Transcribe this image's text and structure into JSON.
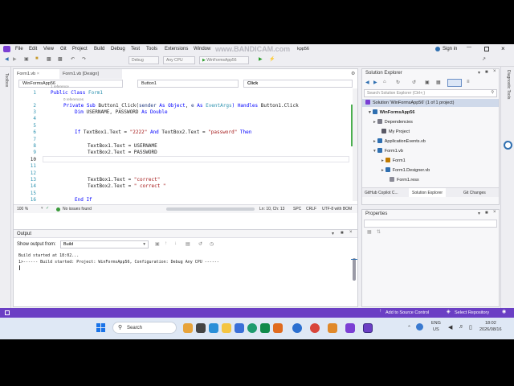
{
  "menu": {
    "items": [
      "File",
      "Edit",
      "View",
      "Git",
      "Project",
      "Build",
      "Debug",
      "Test",
      "Tools",
      "Extensions",
      "Window"
    ],
    "watermark": "www.BANDICAM.com",
    "window_title_suffix": "kpp56",
    "sign_in": "Sign in"
  },
  "toolbar": {
    "config": "Debug",
    "platform": "Any CPU",
    "run": "WinFormsApp56"
  },
  "left_strip": {
    "label": "Toolbox"
  },
  "right_strip": {
    "label": "Diagnostic Tools"
  },
  "editor": {
    "tabs": [
      "Form1.vb",
      "Form1.vb [Design]"
    ],
    "dropdowns": {
      "project": "WinFormsApp56",
      "object": "Button1",
      "event": "Click"
    },
    "references_1": "1 reference",
    "references_2": "0 references",
    "line_numbers": [
      "1",
      "2",
      "3",
      "4",
      "5",
      "6",
      "7",
      "8",
      "9",
      "10",
      "11",
      "12",
      "13",
      "14",
      "15",
      "16"
    ],
    "zoom": "100 %",
    "issues": "No issues found",
    "position": "Ln: 10, Ch: 13",
    "spc": "SPC",
    "crlf": "CRLF",
    "encoding": "UTF-8 with BOM"
  },
  "code": {
    "l1_kw": "Public Class ",
    "l1_name": "Form1",
    "l2_kw": "Private Sub ",
    "l2_rest": "Button1_Click(",
    "l2_sender": "sender",
    "l2_as1": " As ",
    "l2_obj": "Object",
    "l2_comma": ", ",
    "l2_e": "e",
    "l2_as2": " As ",
    "l2_ev": "EventArgs",
    "l2_handles": ") Handles ",
    "l2_tail": "Button1.Click",
    "l3_kw": "Dim ",
    "l3_vars": "USERNAME, PASSWORD ",
    "l3_as": "As ",
    "l3_type": "Double",
    "l6_if": "If ",
    "l6_a": "TextBox1.Text = ",
    "l6_s1": "\"2222\"",
    "l6_and": " And ",
    "l6_b": "TextBox2.Text = ",
    "l6_s2": "\"password\"",
    "l6_then": " Then",
    "l8": "TextBox1.Text = USERNAME",
    "l9": "TextBox2.Text = PASSWORD",
    "l13_a": "TextBox1.Text = ",
    "l13_s": "\"correct\"",
    "l14_a": "TextBox2.Text = ",
    "l14_s": "\" correct \"",
    "l16": "End If"
  },
  "output": {
    "title": "Output",
    "show_from_label": "Show output from:",
    "show_from_value": "Build",
    "line1": "Build started at 18:02...",
    "line2": "1>------ Build started: Project: WinFormsApp56, Configuration: Debug Any CPU ------"
  },
  "solution_explorer": {
    "title": "Solution Explorer",
    "search_placeholder": "Search Solution Explorer (Ctrl+;)",
    "items": [
      "Solution 'WinFormsApp56' (1 of 1 project)",
      "WinFormsApp56",
      "Dependencies",
      "My Project",
      "ApplicationEvents.vb",
      "Form1.vb",
      "Form1",
      "Form1.Designer.vb",
      "Form1.resx"
    ],
    "bottom_tabs": [
      "GitHub Copilot C...",
      "Solution Explorer",
      "Git Changes"
    ]
  },
  "properties": {
    "title": "Properties"
  },
  "statusbar": {
    "add_source": "Add to Source Control",
    "select_repo": "Select Repository"
  },
  "taskbar": {
    "search": "Search",
    "lang1": "ENG",
    "lang2": "US",
    "time": "18:02",
    "date": "2026/08/16"
  },
  "colors": {
    "accent": "#6b3fc4",
    "keyword": "#0000ff",
    "string": "#a31515",
    "type": "#2b91af"
  }
}
